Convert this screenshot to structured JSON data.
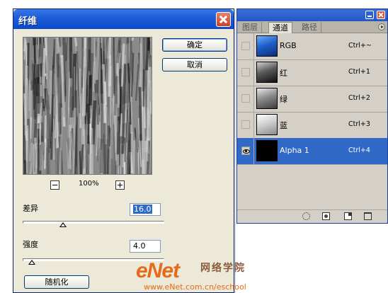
{
  "channels_panel": {
    "tabs": [
      {
        "label": "图层"
      },
      {
        "label": "通道"
      },
      {
        "label": "路径"
      }
    ],
    "channels": [
      {
        "name": "RGB",
        "shortcut": "Ctrl+~",
        "visible": false,
        "selected": false
      },
      {
        "name": "红",
        "shortcut": "Ctrl+1",
        "visible": false,
        "selected": false
      },
      {
        "name": "绿",
        "shortcut": "Ctrl+2",
        "visible": false,
        "selected": false
      },
      {
        "name": "蓝",
        "shortcut": "Ctrl+3",
        "visible": false,
        "selected": false
      },
      {
        "name": "Alpha 1",
        "shortcut": "Ctrl+4",
        "visible": true,
        "selected": true
      }
    ],
    "icons": [
      "dotted-circle-icon",
      "mask-icon",
      "new-channel-icon",
      "trash-icon"
    ]
  },
  "dialog": {
    "title": "纤维",
    "ok_label": "确定",
    "cancel_label": "取消",
    "zoom": "100%",
    "variance": {
      "label": "差异",
      "value": "16.0",
      "fraction": 0.28
    },
    "strength": {
      "label": "强度",
      "value": "4.0",
      "fraction": 0.04
    },
    "randomize_label": "随机化"
  },
  "watermark": {
    "brand": "eNet",
    "brand_cn": "网络学院",
    "url": "www.eNet.com.cn/eschool"
  },
  "colors": {
    "selection": "#3169c6",
    "dialog_bg": "#ece9d8",
    "panel_bg": "#d4d0c8",
    "watermark": "#e56a1a"
  }
}
